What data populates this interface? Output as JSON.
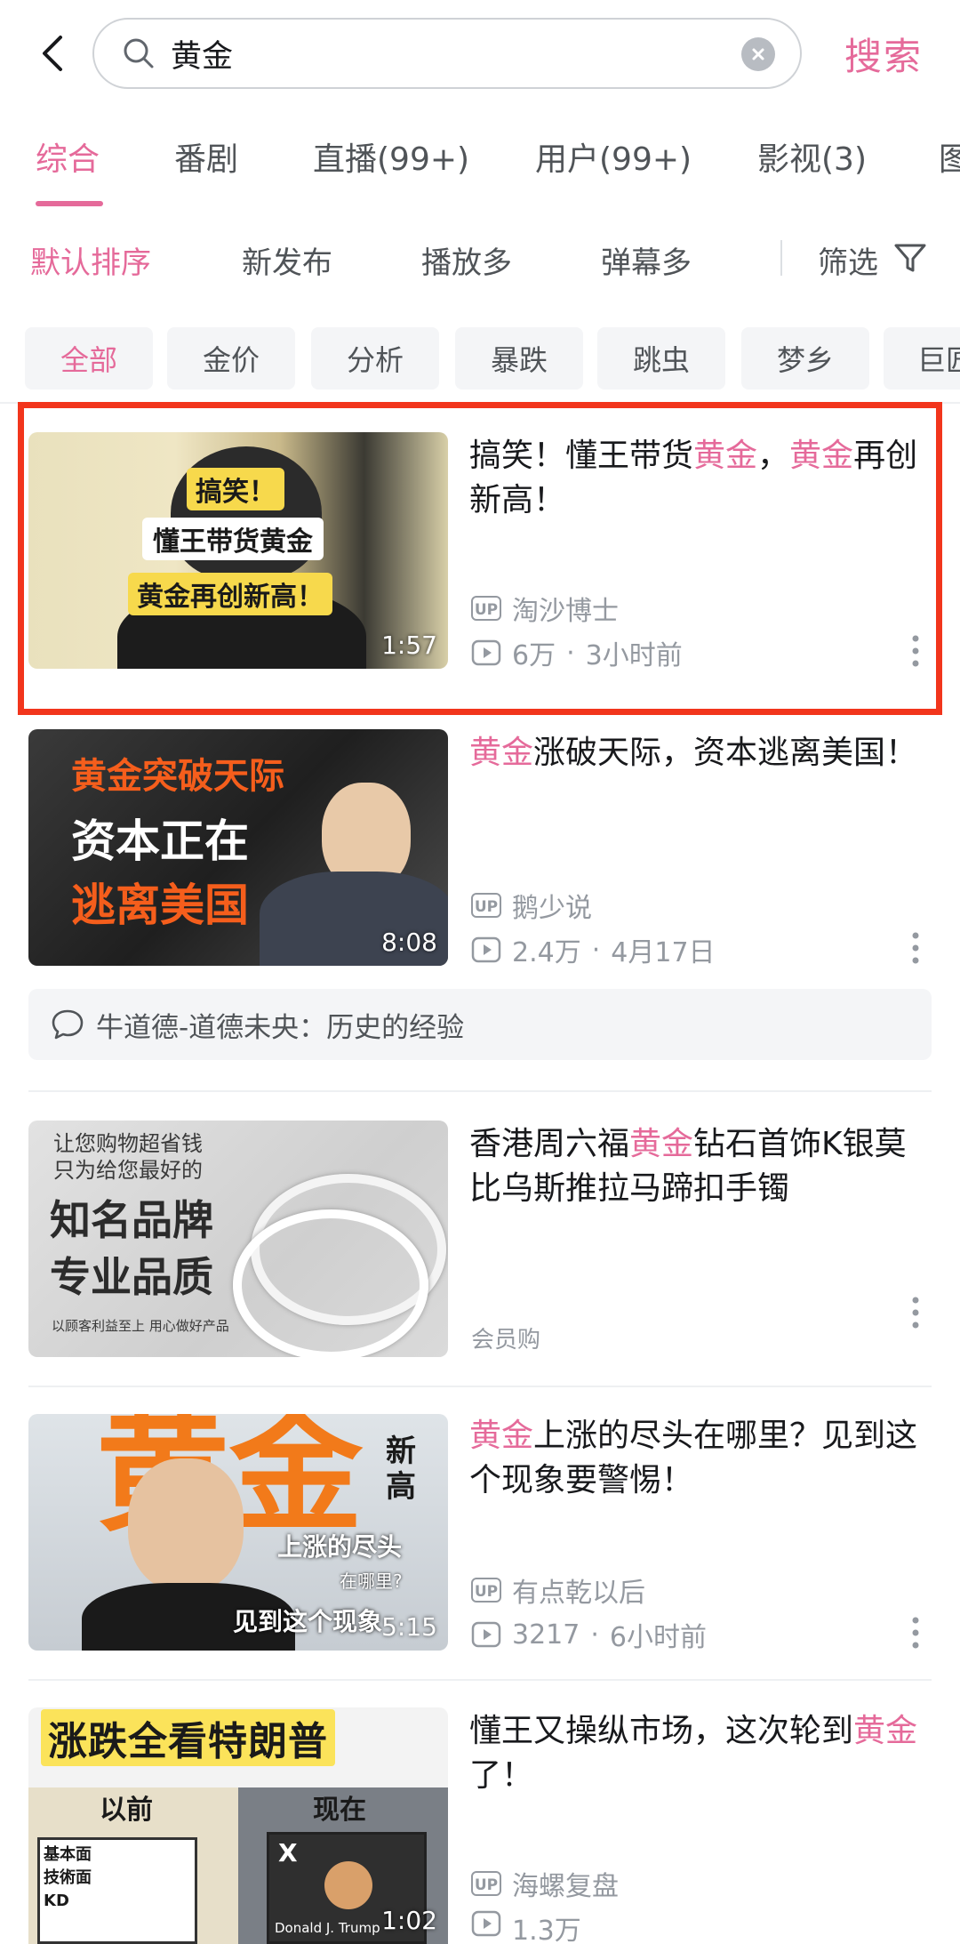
{
  "header": {
    "search_value": "黄金",
    "search_button": "搜索"
  },
  "tabs": [
    "综合",
    "番剧",
    "直播(99+)",
    "用户(99+)",
    "影视(3)",
    "图"
  ],
  "sort": {
    "options": [
      "默认排序",
      "新发布",
      "播放多",
      "弹幕多"
    ],
    "filter_label": "筛选"
  },
  "chips": [
    "全部",
    "金价",
    "分析",
    "暴跌",
    "跳虫",
    "梦乡",
    "巨匠"
  ],
  "videos": [
    {
      "title_parts": [
        "搞笑！懂王带货",
        "黄金",
        "，",
        "黄金",
        "再创新高！"
      ],
      "author": "淘沙博士",
      "views": "6万",
      "time": "3小时前",
      "duration": "1:57",
      "thumb_text": [
        "搞笑！",
        "懂王带货黄金",
        "黄金再创新高！"
      ]
    },
    {
      "title_parts": [
        "黄金",
        "涨破天际，资本逃离美国！"
      ],
      "author": "鹅少说",
      "views": "2.4万",
      "time": "4月17日",
      "duration": "8:08",
      "thumb_text": [
        "黄金突破天际",
        "资本正在",
        "逃离美国"
      ]
    },
    {
      "title_parts": [
        "黄金",
        "上涨的尽头在哪里？见到这个现象要警惕！"
      ],
      "author": "有点乾以后",
      "views": "3217",
      "time": "6小时前",
      "duration": "5:15",
      "thumb_text": [
        "黄金",
        "新高",
        "上涨的尽头",
        "在哪里?",
        "见到这个现象"
      ]
    },
    {
      "title_parts": [
        "懂王又操纵市场，这次轮到",
        "黄金",
        "了！"
      ],
      "author": "海螺复盘",
      "views": "1.3万",
      "duration": "1:02",
      "thumb_text": [
        "涨跌全看特朗普",
        "以前",
        "现在",
        "基本面",
        "技術面",
        "KD",
        "Donald J. Trump"
      ]
    }
  ],
  "comment_bar": "牛道德-道德未央：历史的经验",
  "ad": {
    "title_parts": [
      "香港周六福",
      "黄金",
      "钻石首饰K银莫比乌斯推拉马蹄扣手镯"
    ],
    "source": "会员购",
    "thumb_text": [
      "让您购物超省钱",
      "只为给您最好的",
      "知名品牌",
      "专业品质",
      "以顾客利益至上 用心做好产品"
    ]
  }
}
